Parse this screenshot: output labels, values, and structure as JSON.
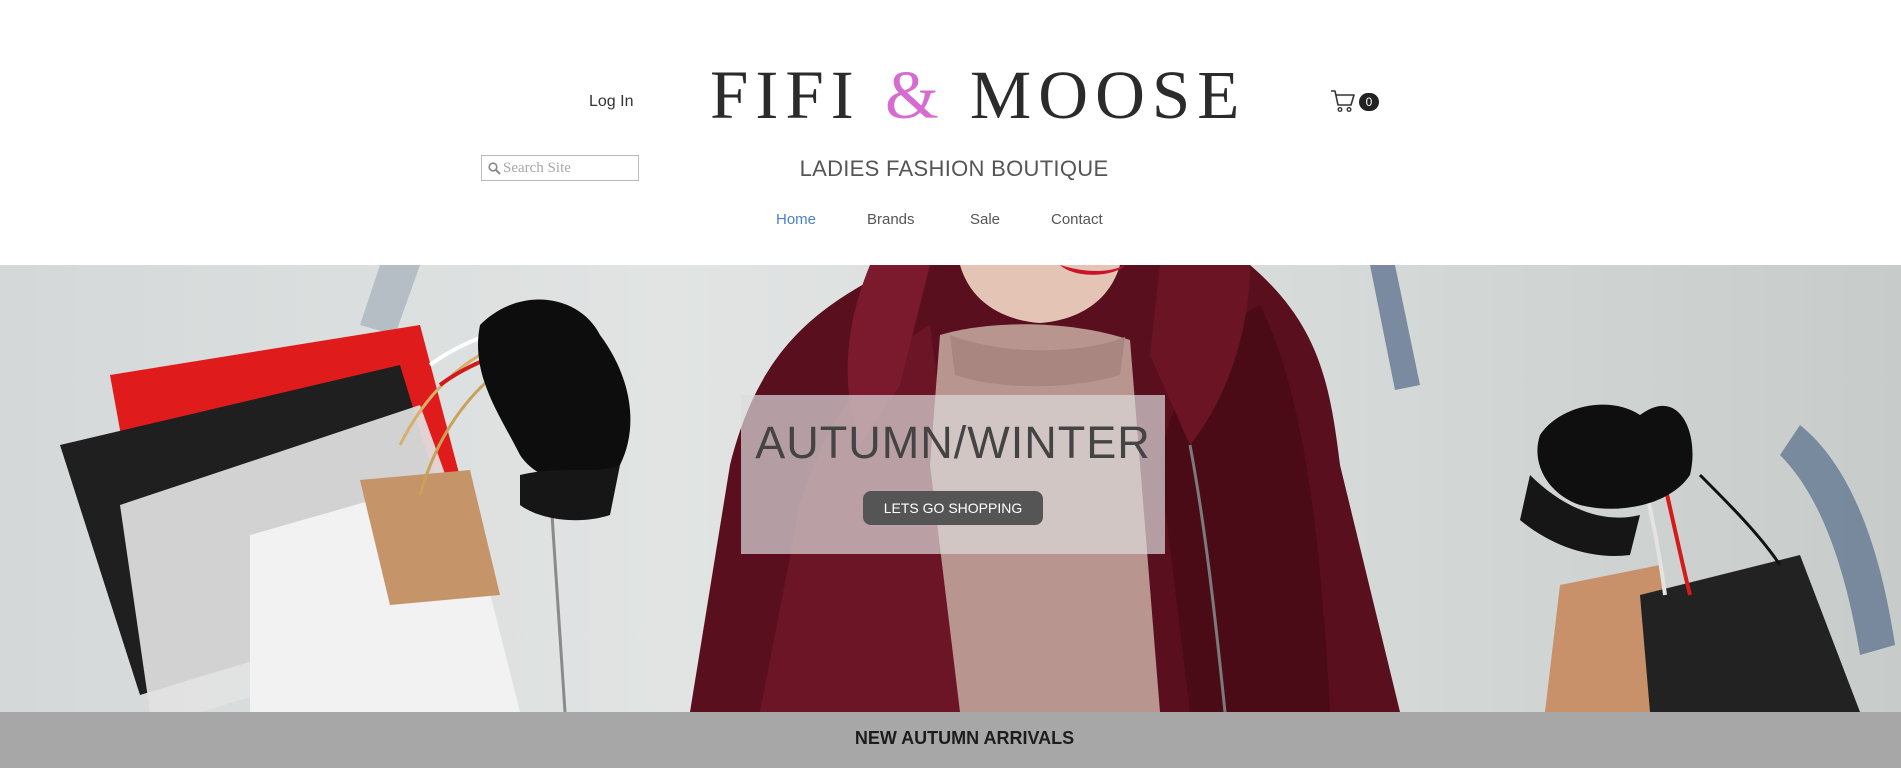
{
  "header": {
    "login_label": "Log In",
    "logo": {
      "part1": "FIFI",
      "amp": "&",
      "part2": "MOOSE",
      "amp_color": "#d66ccf"
    },
    "tagline": "LADIES FASHION BOUTIQUE",
    "cart": {
      "count": "0",
      "icon": "cart-icon"
    },
    "search": {
      "placeholder": "Search Site",
      "value": "",
      "icon": "search-icon"
    }
  },
  "nav": {
    "items": [
      {
        "label": "Home",
        "active": true
      },
      {
        "label": "Brands",
        "active": false
      },
      {
        "label": "Sale",
        "active": false
      },
      {
        "label": "Contact",
        "active": false
      }
    ],
    "active_color": "#4d7fce"
  },
  "hero": {
    "title": "AUTUMN/WINTER",
    "button_label": "LETS GO SHOPPING"
  },
  "section_strip": {
    "label": "NEW AUTUMN ARRIVALS"
  }
}
